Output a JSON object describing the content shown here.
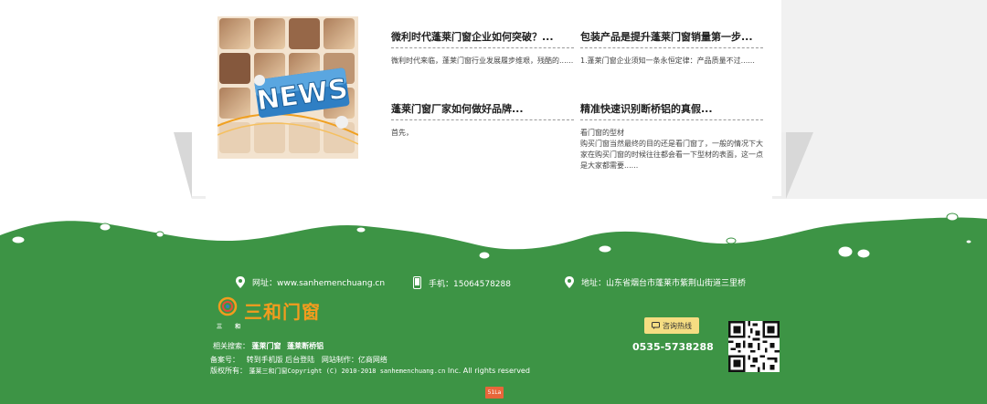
{
  "news": {
    "items": [
      {
        "title": "微利时代蓬莱门窗企业如何突破？...",
        "desc": "微利时代来临，蓬莱门窗行业发展履步维艰，残酷的......"
      },
      {
        "title": "包装产品是提升蓬莱门窗销量第一步...",
        "desc": "1.蓬莱门窗企业须知一条永恒定律：产品质量不过......"
      },
      {
        "title": "蓬莱门窗厂家如何做好品牌...",
        "desc": "首先，"
      },
      {
        "title": "精准快速识别断桥铝的真假...",
        "desc_lines": [
          "看门窗的型材",
          "购买门窗当然最终的目的还是看门窗了，一般的情况下大",
          "家在购买门窗的时候往往都会看一下型材的表面，这一点",
          "是大家都需要......"
        ]
      }
    ]
  },
  "footer": {
    "website": "网址：www.sanhemenchuang.cn",
    "mobile": "手机：15064578288",
    "address": "地址：山东省烟台市蓬莱市紫荆山街道三里桥",
    "logo_text": "三和门窗",
    "logo_mark": "三 和",
    "related_label": "相关搜索：",
    "related_links": [
      "蓬莱门窗",
      "蓬莱断桥铝"
    ],
    "record_label": "备案号：",
    "record_links": "转到手机版 后台登陆",
    "made_by": "网站制作：亿商网络",
    "copyright_prefix": "版权所有：",
    "copyright_text": "蓬莱三和门窗Copyright (C) 2010-2018 sanhemenchuang.cn",
    "rights": "Inc. All rights reserved",
    "hotline_label": "咨询热线",
    "phone": "0535-5738288",
    "badge": "51La"
  },
  "colors": {
    "footer_green": "#3d9445",
    "accent_orange": "#f39c1e",
    "hotline_yellow": "#f5dd82",
    "badge": "#e8663a"
  }
}
